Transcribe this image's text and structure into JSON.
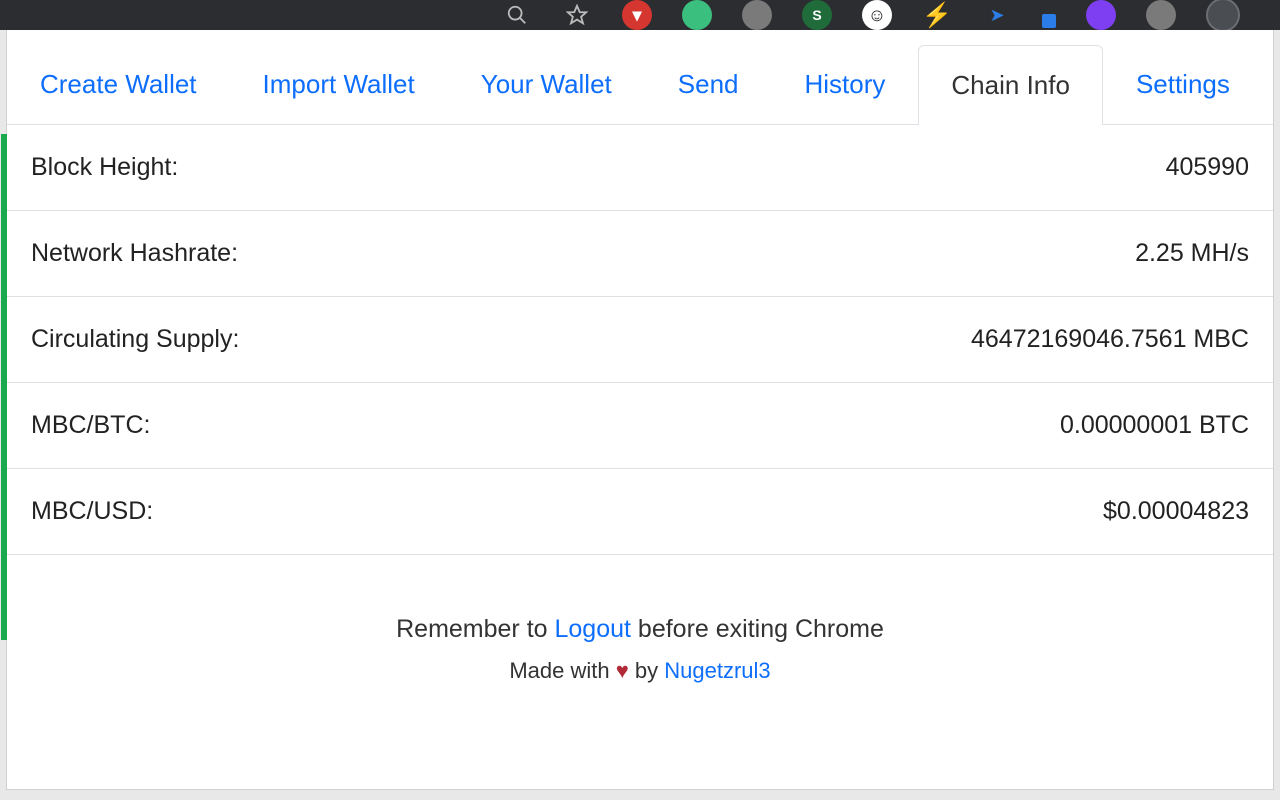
{
  "tabs": {
    "create_wallet": "Create Wallet",
    "import_wallet": "Import Wallet",
    "your_wallet": "Your Wallet",
    "send": "Send",
    "history": "History",
    "chain_info": "Chain Info",
    "settings": "Settings"
  },
  "chain_info": {
    "rows": [
      {
        "label": "Block Height:",
        "value": "405990"
      },
      {
        "label": "Network Hashrate:",
        "value": "2.25 MH/s"
      },
      {
        "label": "Circulating Supply:",
        "value": "46472169046.7561 MBC"
      },
      {
        "label": "MBC/BTC:",
        "value": "0.00000001 BTC"
      },
      {
        "label": "MBC/USD:",
        "value": "$0.00004823"
      }
    ]
  },
  "footer": {
    "remember_pre": "Remember to ",
    "logout": "Logout",
    "remember_post": " before exiting Chrome",
    "made_with": "Made with ",
    "heart": "♥",
    "by": " by ",
    "author": "Nugetzrul3"
  }
}
